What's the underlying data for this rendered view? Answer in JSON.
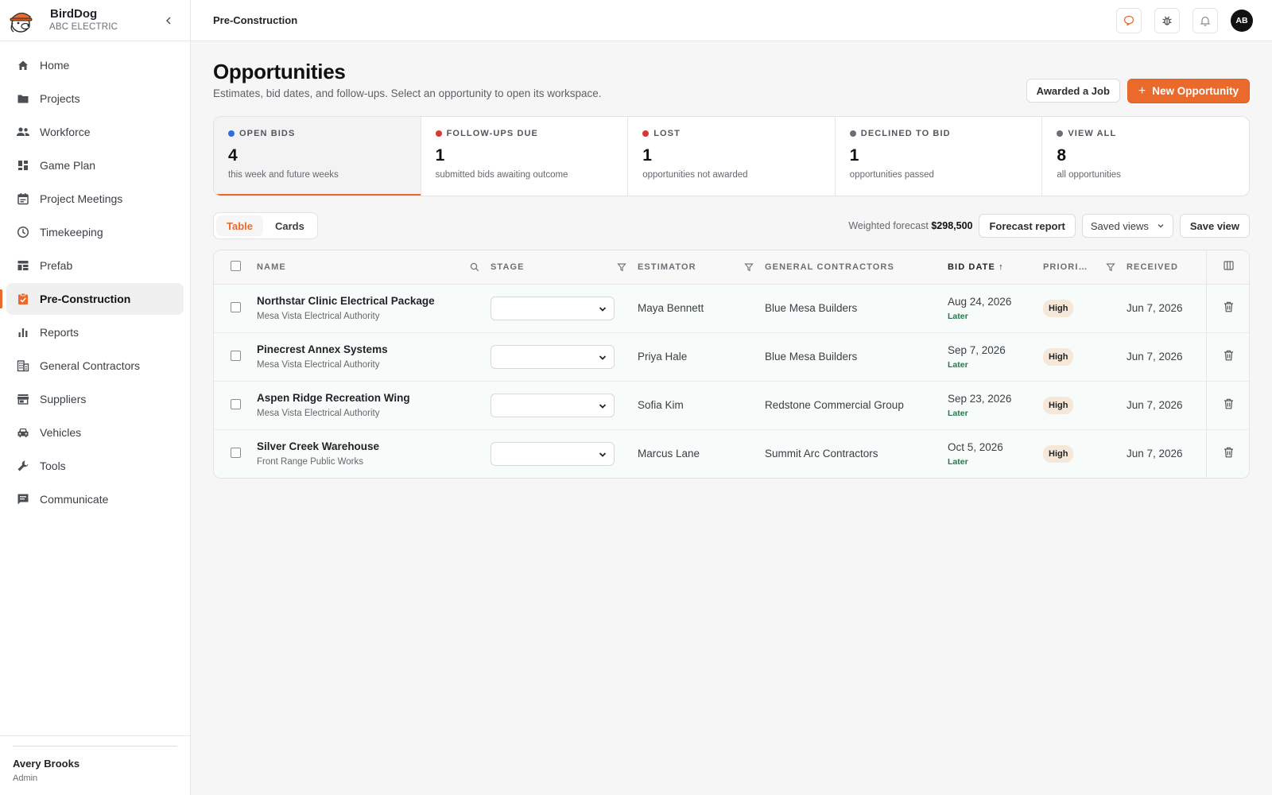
{
  "app": {
    "name": "BirdDog",
    "company": "ABC ELECTRIC",
    "accent": "#ea6a2c"
  },
  "sidebar": {
    "items": [
      {
        "label": "Home",
        "icon": "home-icon"
      },
      {
        "label": "Projects",
        "icon": "folder-icon"
      },
      {
        "label": "Workforce",
        "icon": "people-icon"
      },
      {
        "label": "Game Plan",
        "icon": "dashboard-icon"
      },
      {
        "label": "Project Meetings",
        "icon": "calendar-icon"
      },
      {
        "label": "Timekeeping",
        "icon": "clock-icon"
      },
      {
        "label": "Prefab",
        "icon": "layout-icon"
      },
      {
        "label": "Pre-Construction",
        "icon": "clipboard-icon",
        "active": true
      },
      {
        "label": "Reports",
        "icon": "bar-chart-icon"
      },
      {
        "label": "General Contractors",
        "icon": "building-icon"
      },
      {
        "label": "Suppliers",
        "icon": "store-icon"
      },
      {
        "label": "Vehicles",
        "icon": "car-icon"
      },
      {
        "label": "Tools",
        "icon": "wrench-icon"
      },
      {
        "label": "Communicate",
        "icon": "chat-icon"
      }
    ],
    "user": {
      "name": "Avery Brooks",
      "role": "Admin"
    }
  },
  "header": {
    "breadcrumb": "Pre-Construction",
    "avatar_initials": "AB"
  },
  "page": {
    "title": "Opportunities",
    "subtitle": "Estimates, bid dates, and follow-ups. Select an opportunity to open its workspace.",
    "awarded_label": "Awarded a Job",
    "new_label": "New Opportunity"
  },
  "stats": [
    {
      "label": "OPEN BIDS",
      "value": "4",
      "desc": "this week and future weeks",
      "color": "#2f6fe0"
    },
    {
      "label": "FOLLOW-UPS DUE",
      "value": "1",
      "desc": "submitted bids awaiting outcome",
      "color": "#d93636"
    },
    {
      "label": "LOST",
      "value": "1",
      "desc": "opportunities not awarded",
      "color": "#d93636"
    },
    {
      "label": "DECLINED TO BID",
      "value": "1",
      "desc": "opportunities passed",
      "color": "#6b6f76"
    },
    {
      "label": "VIEW ALL",
      "value": "8",
      "desc": "all opportunities",
      "color": "#6b6f76"
    }
  ],
  "toolbar": {
    "view_table": "Table",
    "view_cards": "Cards",
    "forecast_label": "Weighted forecast",
    "forecast_value": "$298,500",
    "forecast_report": "Forecast report",
    "saved_views": "Saved views",
    "save_view": "Save view"
  },
  "table": {
    "columns": {
      "name": "NAME",
      "stage": "STAGE",
      "estimator": "ESTIMATOR",
      "gcs": "GENERAL CONTRACTORS",
      "bid_date": "BID DATE",
      "bid_sort": "↑",
      "priority": "PRIORI…",
      "received": "RECEIVED"
    },
    "rows": [
      {
        "name": "Northstar Clinic Electrical Package",
        "owner": "Mesa Vista Electrical Authority",
        "estimator": "Maya Bennett",
        "gc": "Blue Mesa Builders",
        "bid_date": "Aug 24, 2026",
        "bid_when": "Later",
        "priority": "High",
        "received": "Jun 7, 2026"
      },
      {
        "name": "Pinecrest Annex Systems",
        "owner": "Mesa Vista Electrical Authority",
        "estimator": "Priya Hale",
        "gc": "Blue Mesa Builders",
        "bid_date": "Sep 7, 2026",
        "bid_when": "Later",
        "priority": "High",
        "received": "Jun 7, 2026"
      },
      {
        "name": "Aspen Ridge Recreation Wing",
        "owner": "Mesa Vista Electrical Authority",
        "estimator": "Sofia Kim",
        "gc": "Redstone Commercial Group",
        "bid_date": "Sep 23, 2026",
        "bid_when": "Later",
        "priority": "High",
        "received": "Jun 7, 2026"
      },
      {
        "name": "Silver Creek Warehouse",
        "owner": "Front Range Public Works",
        "estimator": "Marcus Lane",
        "gc": "Summit Arc Contractors",
        "bid_date": "Oct 5, 2026",
        "bid_when": "Later",
        "priority": "High",
        "received": "Jun 7, 2026"
      }
    ]
  }
}
